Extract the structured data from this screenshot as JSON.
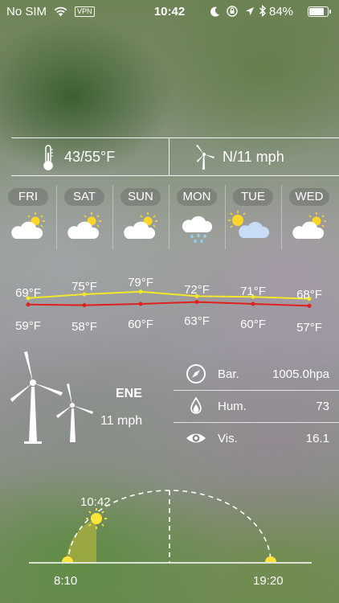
{
  "status_bar": {
    "carrier": "No SIM",
    "vpn": "VPN",
    "time": "10:42",
    "battery_percent": "84%"
  },
  "summary": {
    "temp_range": "43/55°F",
    "wind": "N/11 mph",
    "icons": [
      "thermometer-icon",
      "windmill-icon"
    ]
  },
  "forecast": {
    "days": [
      {
        "label": "FRI",
        "icon": "partly-cloudy-icon"
      },
      {
        "label": "SAT",
        "icon": "partly-cloudy-icon"
      },
      {
        "label": "SUN",
        "icon": "partly-cloudy-icon"
      },
      {
        "label": "MON",
        "icon": "rain-icon"
      },
      {
        "label": "TUE",
        "icon": "sun-cloud-icon"
      },
      {
        "label": "WED",
        "icon": "partly-cloudy-icon"
      }
    ],
    "highs": [
      "69°F",
      "75°F",
      "79°F",
      "72°F",
      "71°F",
      "68°F"
    ],
    "lows": [
      "59°F",
      "58°F",
      "60°F",
      "63°F",
      "60°F",
      "57°F"
    ],
    "high_values": [
      69,
      75,
      79,
      72,
      71,
      68
    ],
    "low_values": [
      59,
      58,
      60,
      63,
      60,
      57
    ],
    "high_color": "#f2e829",
    "low_color": "#e0201c"
  },
  "wind_detail": {
    "direction": "ENE",
    "speed": "11 mph"
  },
  "details": [
    {
      "icon": "compass-icon",
      "label": "Bar.",
      "value": "1005.0hpa"
    },
    {
      "icon": "drop-icon",
      "label": "Hum.",
      "value": "73"
    },
    {
      "icon": "eye-icon",
      "label": "Vis.",
      "value": "16.1"
    }
  ],
  "sun": {
    "current_time": "10:42",
    "sunrise": "8:10",
    "sunset": "19:20",
    "sun_color": "#ffe53a"
  }
}
